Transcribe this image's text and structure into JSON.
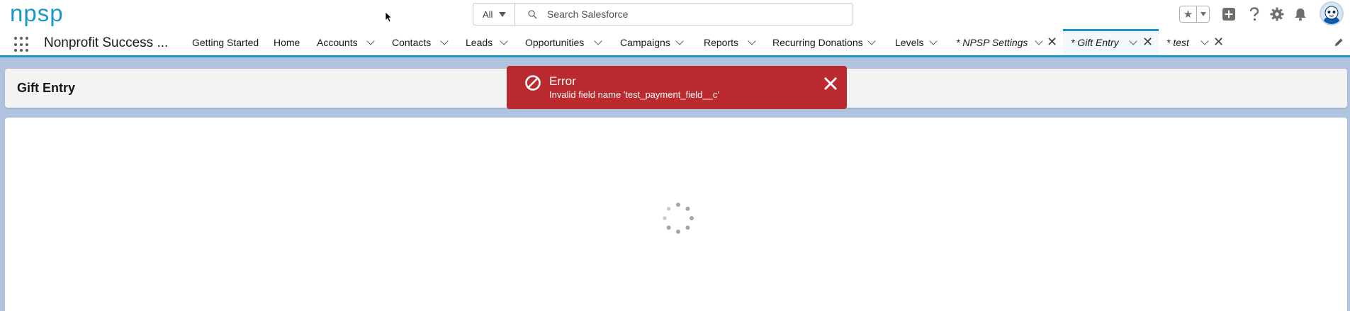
{
  "header": {
    "logo_text": "npsp",
    "search": {
      "scope": "All",
      "placeholder": "Search Salesforce"
    }
  },
  "nav": {
    "app_name": "Nonprofit Success ...",
    "tabs": [
      {
        "label": "Getting Started"
      },
      {
        "label": "Home"
      },
      {
        "label": "Accounts"
      },
      {
        "label": "Contacts"
      },
      {
        "label": "Leads"
      },
      {
        "label": "Opportunities"
      },
      {
        "label": "Campaigns"
      },
      {
        "label": "Reports"
      },
      {
        "label": "Recurring Donations"
      },
      {
        "label": "Levels"
      },
      {
        "label": "* NPSP Settings"
      },
      {
        "label": "* Gift Entry"
      },
      {
        "label": "* test"
      }
    ],
    "active_tab": "* Gift Entry"
  },
  "page": {
    "title": "Gift Entry"
  },
  "toast": {
    "title": "Error",
    "message": "Invalid field name 'test_payment_field__c'",
    "color": "#ba2a2e"
  },
  "colors": {
    "brand": "#1b96c9",
    "background": "#b0c4df"
  }
}
